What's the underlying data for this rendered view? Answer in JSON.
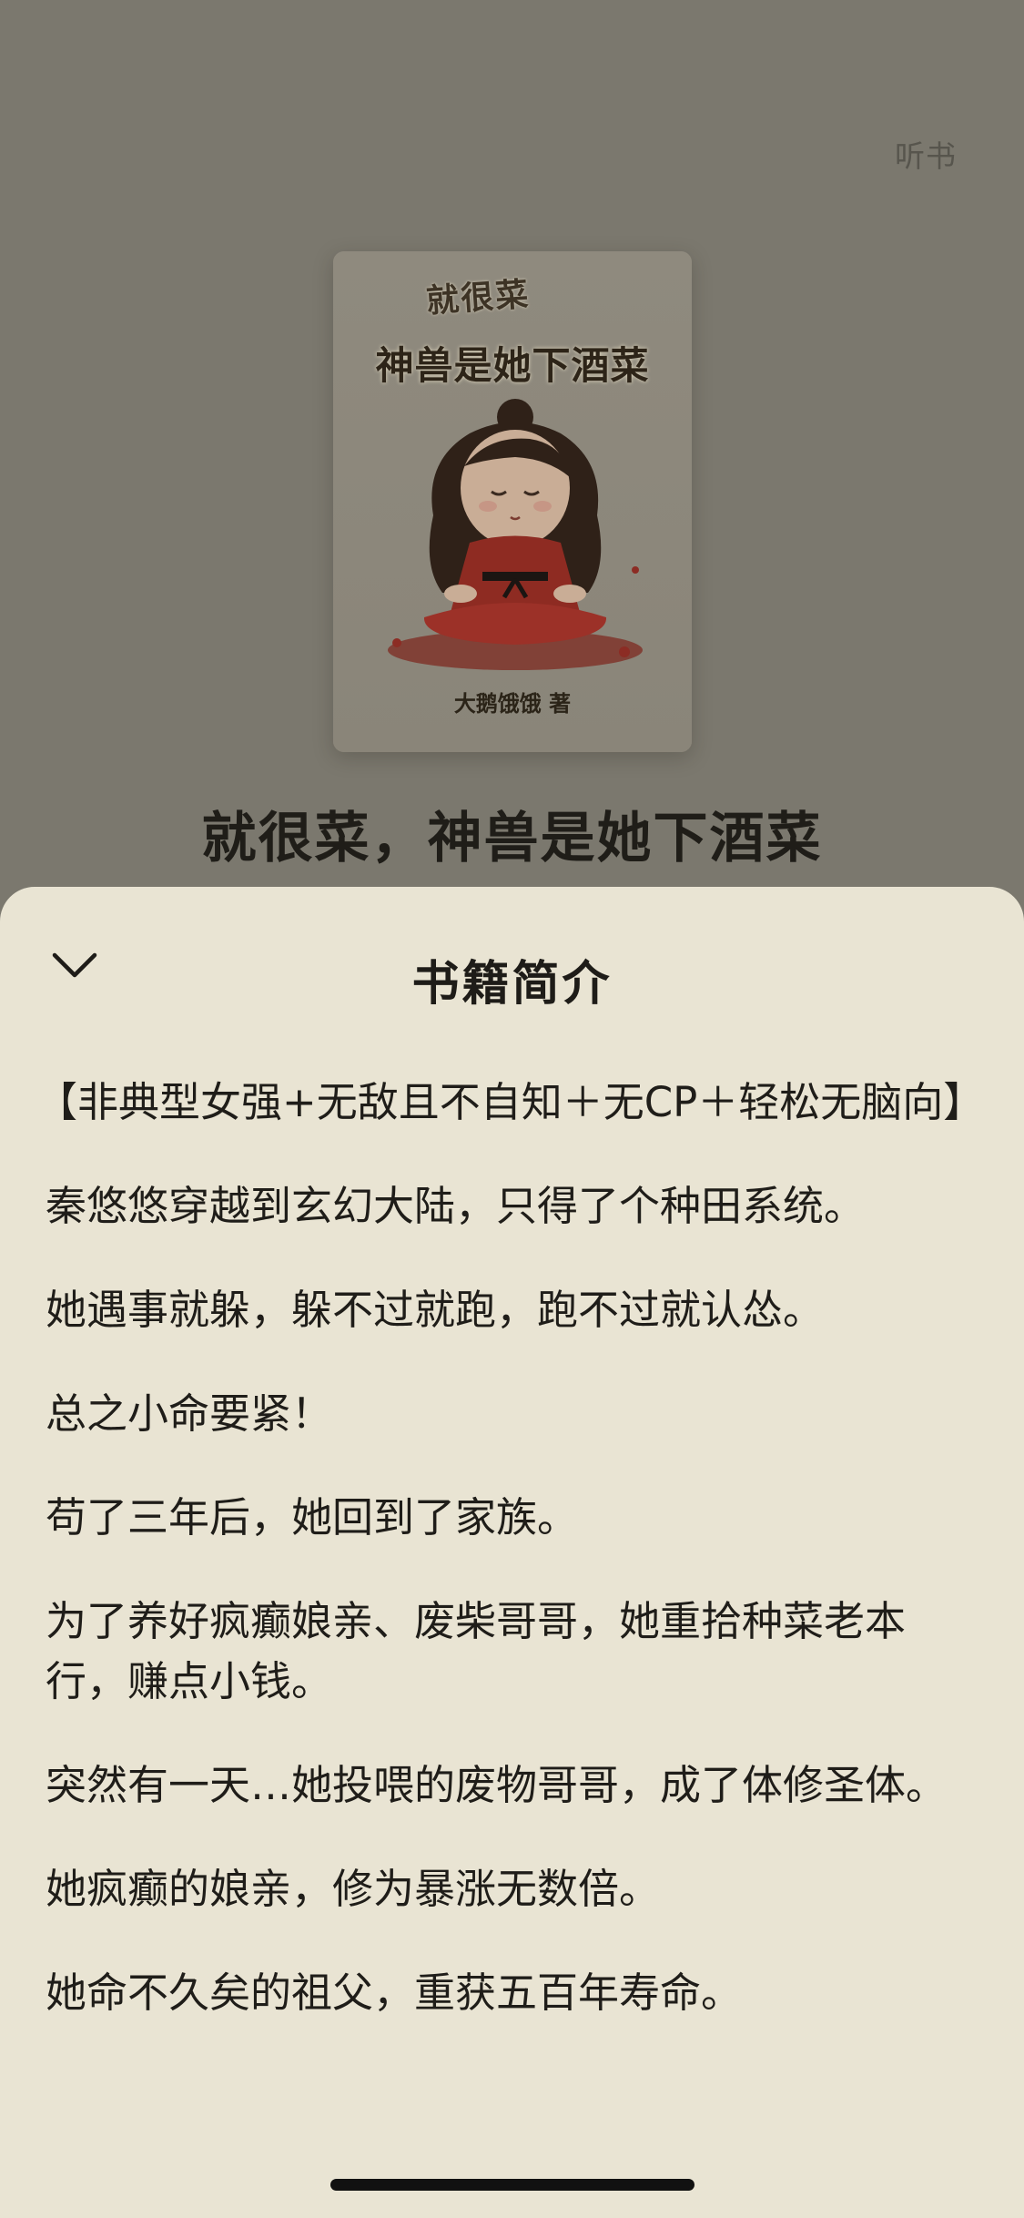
{
  "header": {
    "listen_label": "听书"
  },
  "cover": {
    "subtitle": "就很菜",
    "title": "神兽是她下酒菜",
    "author": "大鹅饿饿 著"
  },
  "book": {
    "title": "就很菜，神兽是她下酒菜"
  },
  "sheet": {
    "title": "书籍简介",
    "collapse_icon": "chevron-down-icon"
  },
  "intro": {
    "paragraphs": [
      "【非典型女强+无敌且不自知＋无CP＋轻松无脑向】",
      "秦悠悠穿越到玄幻大陆，只得了个种田系统。",
      "她遇事就躲，躲不过就跑，跑不过就认怂。",
      "总之小命要紧！",
      "苟了三年后，她回到了家族。",
      "为了养好疯癫娘亲、废柴哥哥，她重拾种菜老本行，赚点小钱。",
      "突然有一天…她投喂的废物哥哥，成了体修圣体。",
      "她疯癫的娘亲，修为暴涨无数倍。",
      "她命不久矣的祖父，重获五百年寿命。"
    ]
  },
  "colors": {
    "sheet_bg": "#e9e4d3",
    "overlay_bg": "#7b786e",
    "text": "#1f1d19"
  }
}
